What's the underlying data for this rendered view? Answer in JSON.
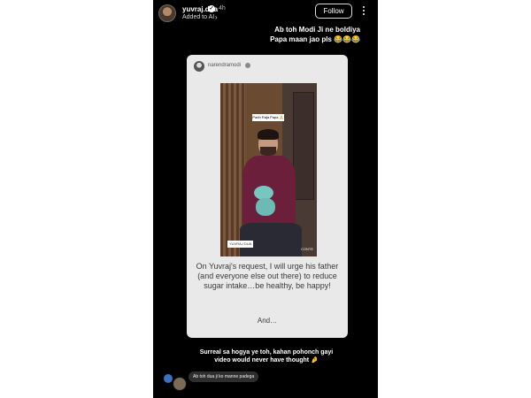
{
  "header": {
    "username": "yuvraj.dua",
    "time": "4h",
    "subline": "Added to AI",
    "follow_label": "Follow"
  },
  "caption": {
    "line1": "Ab toh Modi Ji ne boldiya",
    "line2": "Papa maan jao pls 😂😂😂"
  },
  "shared_post": {
    "username": "narendramodi",
    "video_overlay": "Padh Raja Papa 🙏",
    "video_tag": "YUVRAJ DUA",
    "video_mark": "CONTE",
    "text": "On Yuvraj's request, I will urge his father (and everyone else out there) to reduce sugar intake…be healthy, be happy!",
    "and_text": "And…"
  },
  "bottom_caption": {
    "line1": "Surreal sa hogya ye toh, kahan pohonch gayi",
    "line2": "video would never have thought 🤌"
  },
  "comment": {
    "text": "Ab toh dua ji ko manne padega"
  }
}
